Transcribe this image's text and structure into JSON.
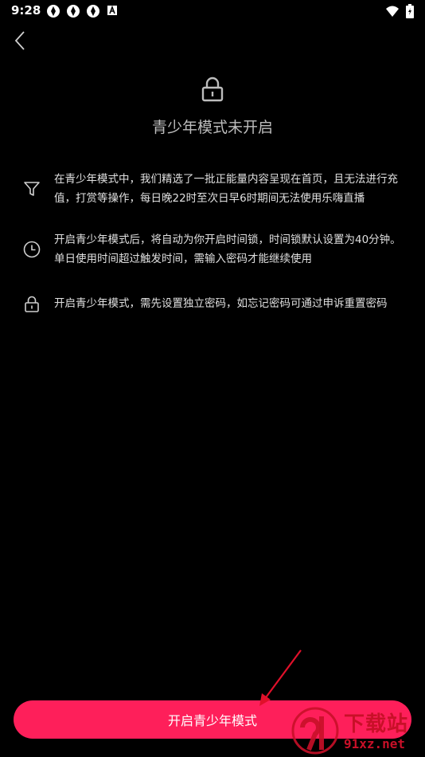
{
  "status_bar": {
    "time": "9:28"
  },
  "header": {
    "title": "青少年模式未开启"
  },
  "info_items": [
    {
      "icon": "filter-icon",
      "text": "在青少年模式中，我们精选了一批正能量内容呈现在首页，且无法进行充值，打赏等操作，每日晚22时至次日早6时期间无法使用乐嗨直播"
    },
    {
      "icon": "clock-icon",
      "text": "开启青少年模式后，将自动为你开启时间锁，时间锁默认设置为40分钟。单日使用时间超过触发时间，需输入密码才能继续使用"
    },
    {
      "icon": "lock-icon",
      "text": "开启青少年模式，需先设置独立密码，如忘记密码可通过申诉重置密码"
    }
  ],
  "primary_button": {
    "label": "开启青少年模式"
  },
  "watermark": {
    "text": "下载站",
    "url": "91xz.net"
  },
  "colors": {
    "accent": "#fe1f5a",
    "background": "#000000",
    "arrow": "#e0102a"
  }
}
